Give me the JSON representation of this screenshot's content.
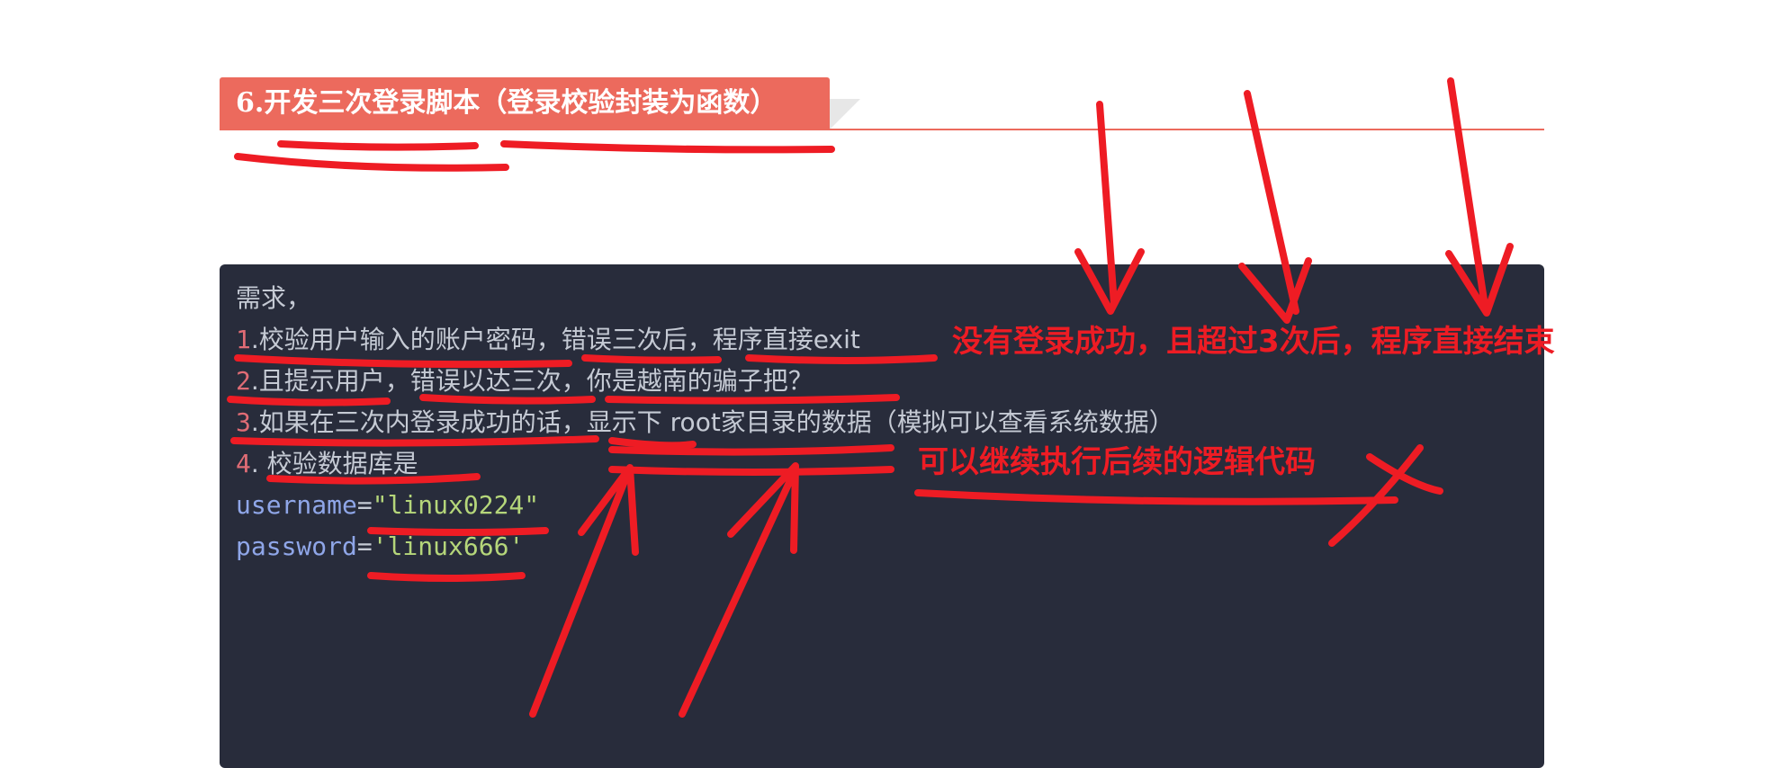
{
  "heading": {
    "title": "6.开发三次登录脚本（登录校验封装为函数）"
  },
  "code": {
    "line0": "需求，",
    "line1_num": "1",
    "line1_text": ".校验用户输入的账户密码，错误三次后，程序直接exit",
    "line2_num": "2",
    "line2_text": ".且提示用户，错误以达三次，你是越南的骗子把？",
    "line3_num": "3",
    "line3_text": ".如果在三次内登录成功的话，显示下 root家目录的数据（模拟可以查看系统数据）",
    "line4_num": "4",
    "line4_text": ". 校验数据库是",
    "line5_var": "username",
    "line5_op": "=",
    "line5_str": "\"linux0224\"",
    "line6_var": "password",
    "line6_op": "=",
    "line6_str": "'linux666'"
  },
  "annotations": {
    "note1": "没有登录成功，且超过3次后，程序直接结束",
    "note2": "可以继续执行后续的逻辑代码"
  },
  "colors": {
    "heading_bg": "#ec6a5d",
    "code_bg": "#282c3b",
    "annotation_red": "#ee1c24"
  }
}
